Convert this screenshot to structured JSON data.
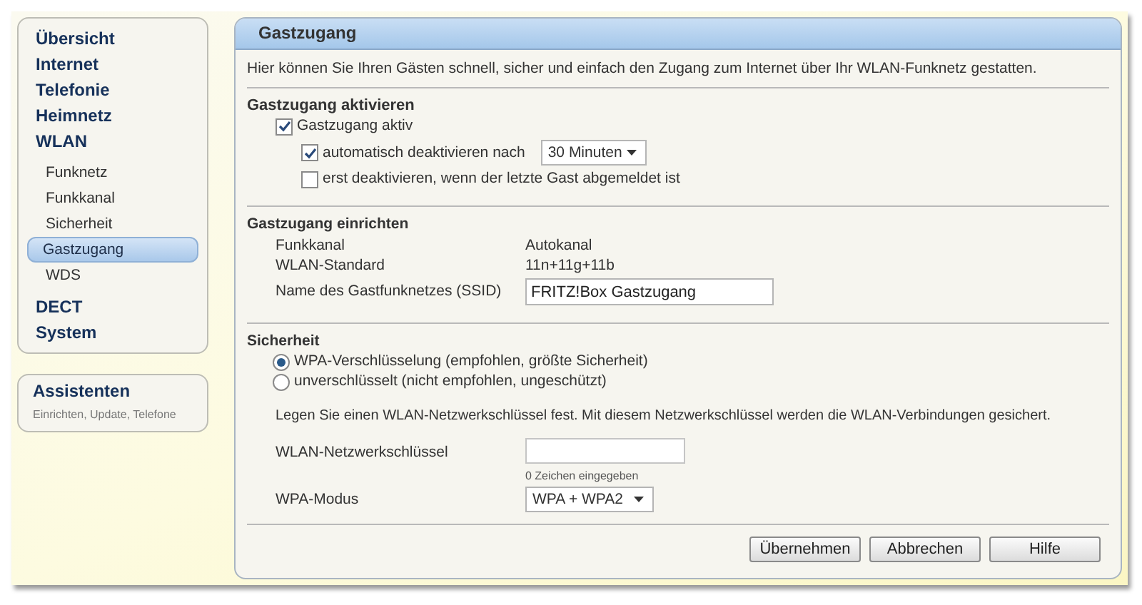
{
  "sidebar": {
    "items": [
      {
        "label": "Übersicht",
        "selected": false
      },
      {
        "label": "Internet",
        "selected": false
      },
      {
        "label": "Telefonie",
        "selected": false
      },
      {
        "label": "Heimnetz",
        "selected": false
      },
      {
        "label": "WLAN",
        "selected": false,
        "children": [
          {
            "label": "Funknetz",
            "selected": false
          },
          {
            "label": "Funkkanal",
            "selected": false
          },
          {
            "label": "Sicherheit",
            "selected": false
          },
          {
            "label": "Gastzugang",
            "selected": true
          },
          {
            "label": "WDS",
            "selected": false
          }
        ]
      },
      {
        "label": "DECT",
        "selected": false
      },
      {
        "label": "System",
        "selected": false
      }
    ]
  },
  "assistant": {
    "title": "Assistenten",
    "subtitle": "Einrichten, Update, Telefone"
  },
  "panel": {
    "title": "Gastzugang",
    "intro": "Hier können Sie Ihren Gästen schnell, sicher und einfach den Zugang zum Internet über Ihr WLAN-Funknetz gestatten.",
    "activate": {
      "title": "Gastzugang aktivieren",
      "main_checkbox": {
        "label": "Gastzugang aktiv",
        "checked": true
      },
      "auto_off": {
        "label": "automatisch deaktivieren nach",
        "checked": true,
        "value": "30 Minuten"
      },
      "last_guest": {
        "label": "erst deaktivieren, wenn der letzte Gast abgemeldet ist",
        "checked": false
      }
    },
    "setup": {
      "title": "Gastzugang einrichten",
      "rows": [
        {
          "label": "Funkkanal",
          "value": "Autokanal"
        },
        {
          "label": "WLAN-Standard",
          "value": "11n+11g+11b"
        }
      ],
      "ssid": {
        "label": "Name des Gastfunknetzes (SSID)",
        "value": "FRITZ!Box Gastzugang"
      }
    },
    "security": {
      "title": "Sicherheit",
      "options": [
        {
          "label": "WPA-Verschlüsselung (empfohlen, größte Sicherheit)",
          "selected": true
        },
        {
          "label": "unverschlüsselt (nicht empfohlen, ungeschützt)",
          "selected": false
        }
      ],
      "note": "Legen Sie einen WLAN-Netzwerkschlüssel fest. Mit diesem Netzwerkschlüssel werden die WLAN-Verbindungen gesichert.",
      "key": {
        "label": "WLAN-Netzwerkschlüssel",
        "hint": "0 Zeichen eingegeben"
      },
      "mode": {
        "label": "WPA-Modus",
        "value": "WPA + WPA2"
      }
    },
    "buttons": [
      "Übernehmen",
      "Abbrechen",
      "Hilfe"
    ]
  }
}
